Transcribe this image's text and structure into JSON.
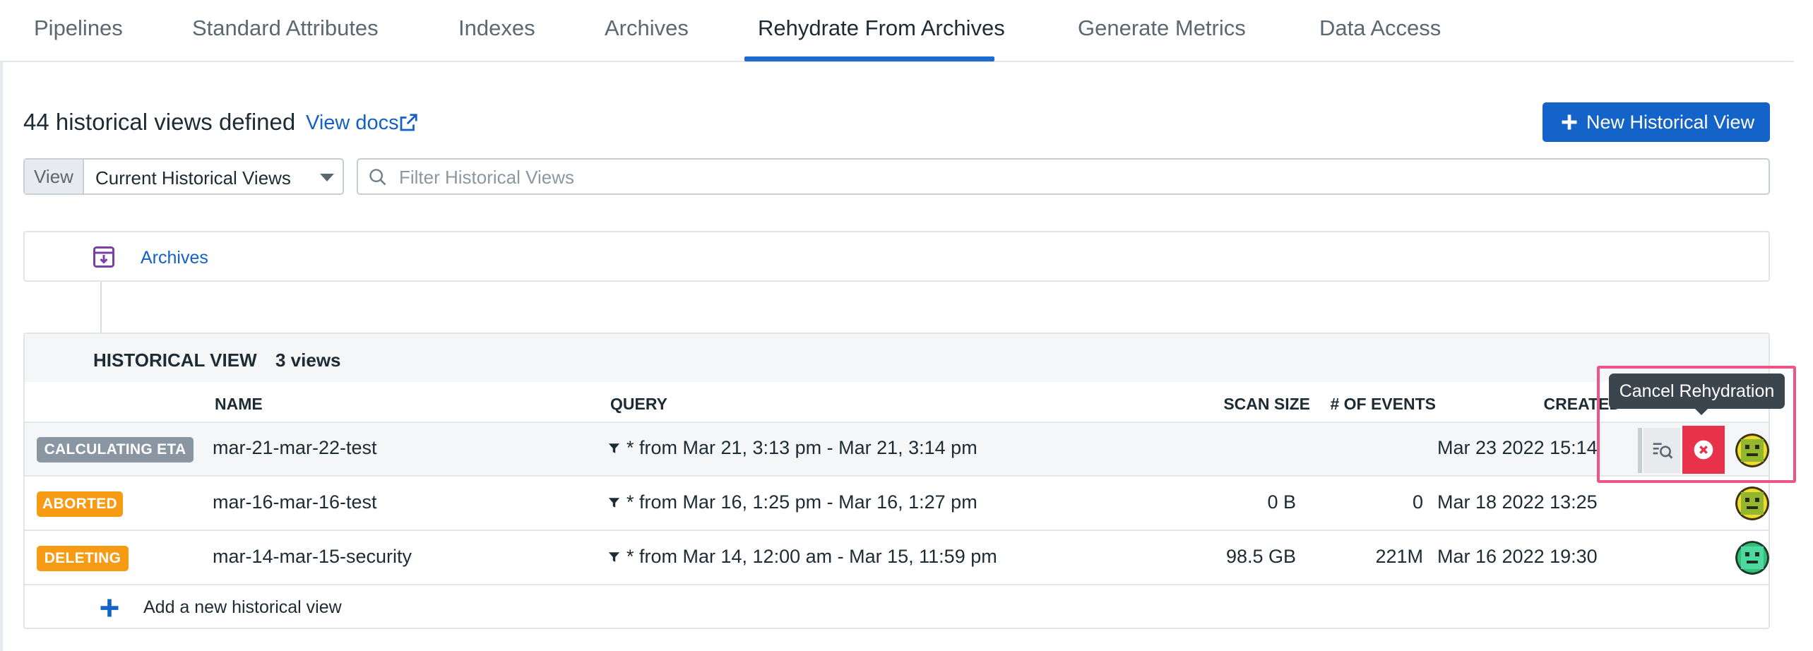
{
  "tabs": [
    {
      "label": "Pipelines"
    },
    {
      "label": "Standard Attributes"
    },
    {
      "label": "Indexes"
    },
    {
      "label": "Archives"
    },
    {
      "label": "Rehydrate From Archives",
      "active": true
    },
    {
      "label": "Generate Metrics"
    },
    {
      "label": "Data Access"
    }
  ],
  "header": {
    "title": "44 historical views defined",
    "docs_link": "View docs",
    "new_button": "New Historical View"
  },
  "view_selector": {
    "label": "View",
    "value": "Current Historical Views"
  },
  "filter": {
    "placeholder": "Filter Historical Views"
  },
  "archives_link": "Archives",
  "table": {
    "title": "HISTORICAL VIEW",
    "count": "3 views",
    "columns": {
      "name": "NAME",
      "query": "QUERY",
      "scan_size": "SCAN SIZE",
      "events": "# OF EVENTS",
      "created": "CREATED"
    },
    "rows": [
      {
        "status": "CALCULATING ETA",
        "status_color": "#8b96a3",
        "name": "mar-21-mar-22-test",
        "query": "* from Mar 21, 3:13 pm - Mar 21, 3:14 pm",
        "scan_size": "",
        "events": "",
        "created": "Mar 23 2022 15:14"
      },
      {
        "status": "ABORTED",
        "status_color": "#f79a14",
        "name": "mar-16-mar-16-test",
        "query": "* from Mar 16, 1:25 pm - Mar 16, 1:27 pm",
        "scan_size": "0 B",
        "events": "0",
        "created": "Mar 18 2022 13:25"
      },
      {
        "status": "DELETING",
        "status_color": "#f79a14",
        "name": "mar-14-mar-15-security",
        "query": "* from Mar 14, 12:00 am - Mar 15, 11:59 pm",
        "scan_size": "98.5 GB",
        "events": "221M",
        "created": "Mar 16 2022 19:30"
      }
    ],
    "add_link": "Add a new historical view"
  },
  "tooltip": "Cancel Rehydration",
  "colors": {
    "primary": "#1463c8",
    "link": "#1560c6",
    "danger": "#e8324a",
    "warning": "#f79a14",
    "highlight": "#ee5485"
  },
  "icons": {
    "external": "external-link-icon",
    "plus": "plus-icon",
    "search": "search-icon",
    "archive": "archive-icon",
    "funnel": "filter-funnel-icon",
    "cancel": "cancel-circle-icon",
    "query_search": "query-search-icon",
    "avatar": "user-avatar-icon"
  }
}
